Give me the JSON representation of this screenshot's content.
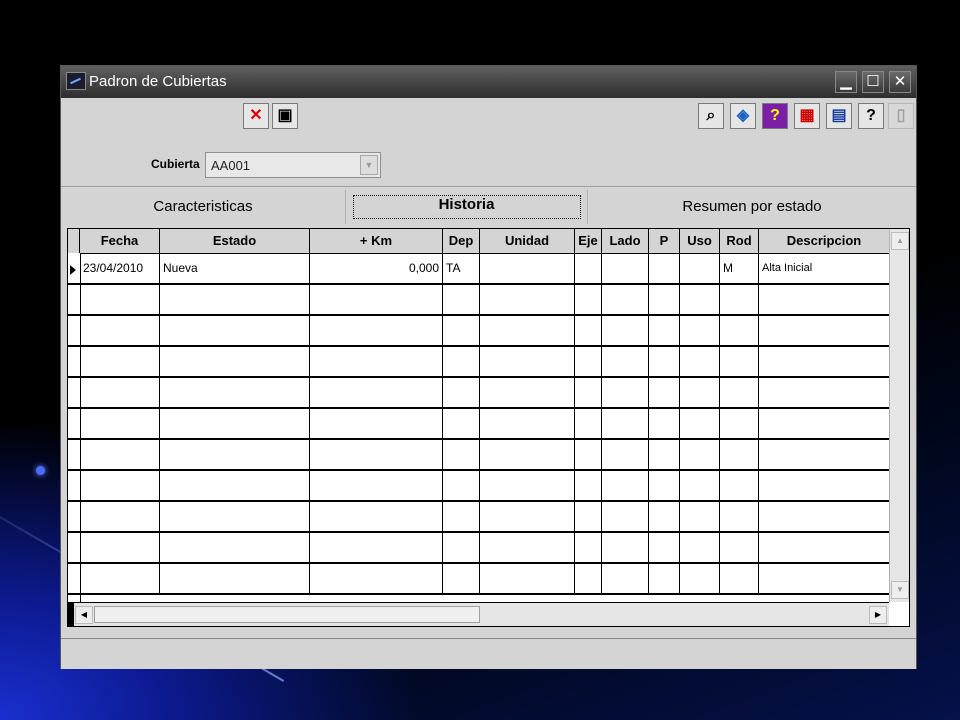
{
  "window": {
    "title": "Padron de Cubiertas",
    "minimize_glyph": "▁",
    "maximize_glyph": "☐",
    "close_glyph": "✕"
  },
  "toolbar": {
    "left_icons": [
      {
        "name": "cancel-icon",
        "glyph": "✕",
        "color": "#e00000"
      },
      {
        "name": "save-icon",
        "glyph": "▣",
        "color": "#000000"
      }
    ],
    "right_icons": [
      {
        "name": "binoculars-icon",
        "glyph": "⌕",
        "color": "#000000"
      },
      {
        "name": "tag-icon",
        "glyph": "◈",
        "color": "#1a60c0"
      },
      {
        "name": "help-box-icon",
        "glyph": "?",
        "color": "#ffff00"
      },
      {
        "name": "report-icon",
        "glyph": "▦",
        "color": "#cc0000"
      },
      {
        "name": "calculator-icon",
        "glyph": "▤",
        "color": "#1a3ea0"
      },
      {
        "name": "question-icon",
        "glyph": "?",
        "color": "#000000"
      },
      {
        "name": "exit-icon",
        "glyph": "▯",
        "color": "#a0a0a0"
      }
    ]
  },
  "filter": {
    "label": "Cubierta",
    "value": "AA001",
    "arrow_glyph": "▼"
  },
  "tabs": [
    {
      "label": "Caracteristicas"
    },
    {
      "label": "Historia"
    },
    {
      "label": "Resumen por estado"
    }
  ],
  "grid": {
    "columns": [
      "Fecha",
      "Estado",
      "+ Km",
      "Dep",
      "Unidad",
      "Eje",
      "Lado",
      "P",
      "Uso",
      "Rod",
      "Descripcion"
    ],
    "rows": [
      [
        "23/04/2010",
        "Nueva",
        "0,000",
        "TA",
        "",
        "",
        "",
        "",
        "",
        "M",
        "Alta Inicial"
      ]
    ],
    "scroll_up_glyph": "▲",
    "scroll_down_glyph": "▼",
    "scroll_left_glyph": "◀",
    "scroll_right_glyph": "▶"
  }
}
